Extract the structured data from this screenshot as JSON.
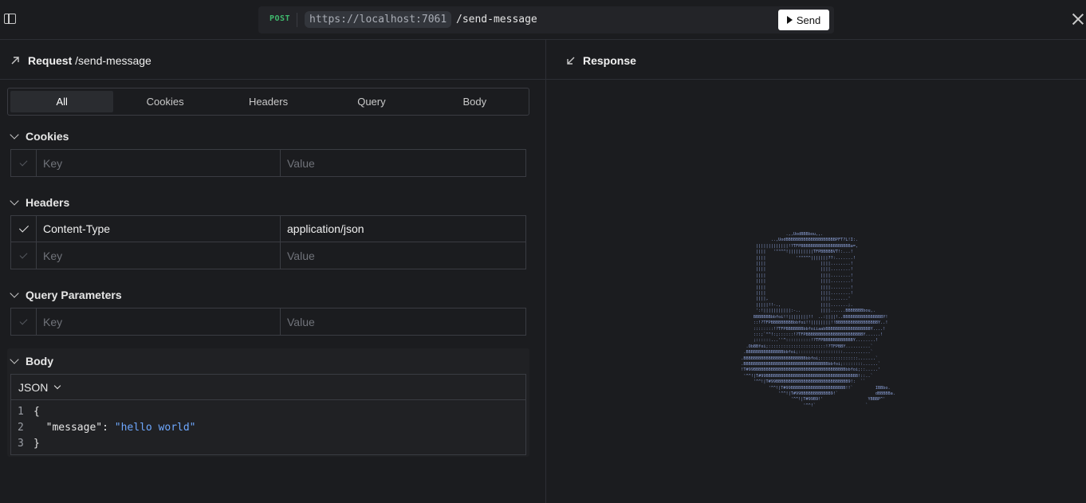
{
  "topbar": {
    "method": "POST",
    "base_url": "https://localhost:7061",
    "path": "/send-message",
    "send_label": "Send"
  },
  "request": {
    "title": "Request",
    "path": "/send-message",
    "tabs": [
      {
        "label": "All",
        "active": true
      },
      {
        "label": "Cookies",
        "active": false
      },
      {
        "label": "Headers",
        "active": false
      },
      {
        "label": "Query",
        "active": false
      },
      {
        "label": "Body",
        "active": false
      }
    ],
    "cookies": {
      "title": "Cookies",
      "rows": [
        {
          "key": "",
          "value": "",
          "enabled": false
        }
      ]
    },
    "headers": {
      "title": "Headers",
      "rows": [
        {
          "key": "Content-Type",
          "value": "application/json",
          "enabled": true
        },
        {
          "key": "",
          "value": "",
          "enabled": false
        }
      ]
    },
    "query": {
      "title": "Query Parameters",
      "rows": [
        {
          "key": "",
          "value": "",
          "enabled": false
        }
      ]
    },
    "key_placeholder": "Key",
    "value_placeholder": "Value",
    "body": {
      "title": "Body",
      "format": "JSON",
      "lines": [
        {
          "num": "1",
          "text": "{"
        },
        {
          "num": "2",
          "key": "\"message\"",
          "sep": ": ",
          "value": "\"hello world\""
        },
        {
          "num": "3",
          "text": "}"
        }
      ]
    }
  },
  "response": {
    "title": "Response",
    "ascii_art": "                    .,,UodBBBbou,,.\n              ..,UodBBBBBBBBBBBBBBBBBBBBPFT?L!I:.\n        |||||||||||||!?TFPBBBBBBBBBBBBBBBBBBBBa=,\n        ||||   '\"\"^^!||||||||||TFPBBBBBVT!:...!\n        ||||            '\"\"\"^^|||||||??:.......!\n        ||||                      ||||........!\n        ||||                      ||||........!\n        ||||                      ||||........!\n        ||||                      ||||........!\n        ||||                      ||||........!\n        ||||                      ||||........!\n        ||||,                     ||||.......'\n        |||||!!-.,                ||||.......;.\n        ':!|||||||||||:-..        ||||......BBBBBBBbou,.\n       BBBBBBBbbfoi!!||||||||!!  ..:||||!..BBBBBBBBBBBBBBBBY!\n       ::!?TFPBBBBBBBBBbbfoi!!||||||||!!BBBBBBBBBBBBBBBBBY..!\n       ::::::::!?TFPBBBBBBBbbfoiiaabBBBBBBBBBBBBBBBBBBY....!\n       :::;`\"^!:;::::::!?TFPBBBBBBBBBBBBBBBBBBBBBBBY......!\n       ;::::::...''^::::::::::!?TFPBBBBBBBBBBBBY........!\n    .ObBBfoi;:::::::::::::::::::::::!?TFPBBY..........`\n   .BBBBBBBBBBBBBBBbbfoi;::::::::::::::::::...........`\n  .BBBBBBBBBBBBBBBBBBBBBBBBBbbfoi;:::::::::::::::.......`\n  .BBBBBBBBBBBBBBBBBBBBBBBBBBBBBBBBBBbbfoi;::::::::......`\n  !T#99BBBBBBBBBBBBBBBBBBBBBBBBBBBBBBBBBBBBBbbfoi;::.....'\n   '^^!|T#99BBBBBBBBBBBBBBBBBBBBBBBBBBBBBBBBBBBBB!::..`\n       '^^!|T#99BBBBBBBBBBBBBBBBBBBBBBBBBBBBB9!:  ``\n             '^^!|T#99BBBBBBBBBBBBBBBBBBBBBB!!`         IBBbo.\n                 '^^!|T#99BBBBBBBBBBBB9!`               dBBBBBa.\n                      '^^!|T#99B9!'                  YBBBP^'\n                           '^^!`                    `"
  }
}
